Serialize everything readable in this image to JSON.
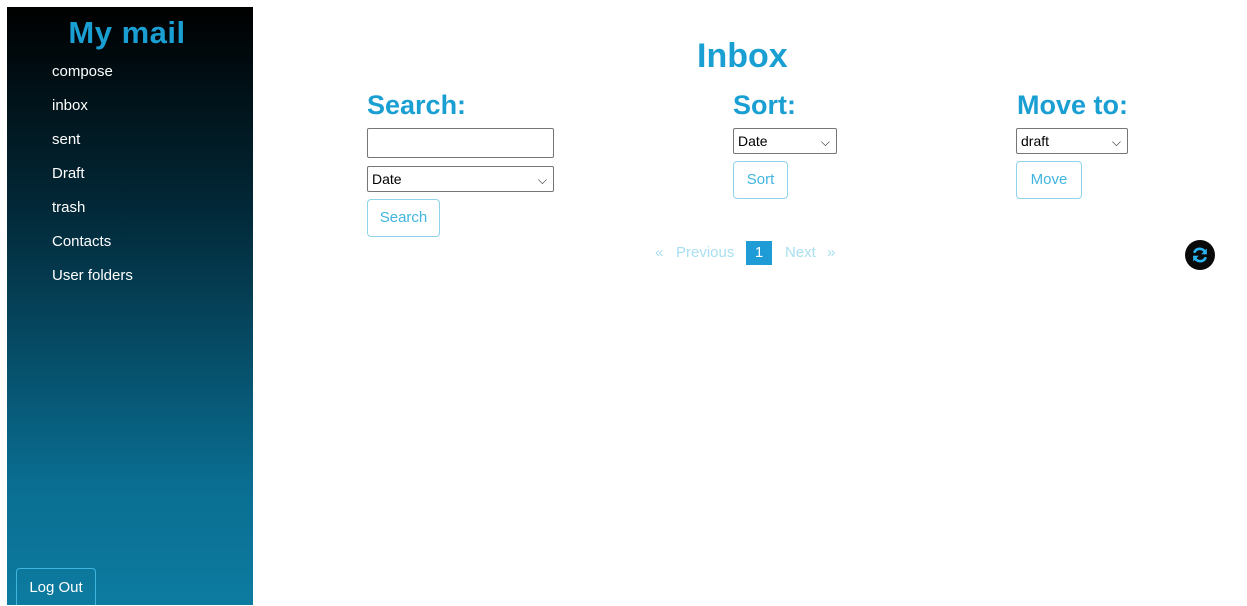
{
  "sidebar": {
    "brand": "My mail",
    "items": [
      {
        "label": "compose"
      },
      {
        "label": "inbox"
      },
      {
        "label": "sent"
      },
      {
        "label": "Draft"
      },
      {
        "label": "trash"
      },
      {
        "label": "Contacts"
      },
      {
        "label": "User folders"
      }
    ],
    "logout_label": "Log Out"
  },
  "main": {
    "title": "Inbox",
    "search": {
      "label": "Search:",
      "input_value": "",
      "select_value": "Date",
      "button_label": "Search"
    },
    "sort": {
      "label": "Sort:",
      "select_value": "Date",
      "button_label": "Sort"
    },
    "move": {
      "label": "Move to:",
      "select_value": "draft",
      "button_label": "Move"
    },
    "pagination": {
      "prev_arrow": "«",
      "prev_label": "Previous",
      "current_page": "1",
      "next_label": "Next",
      "next_arrow": "»"
    },
    "refresh_icon": "refresh-icon"
  },
  "colors": {
    "accent": "#1a9fd3",
    "active_page": "#1f9bd6",
    "button_text": "#3fb5e0"
  }
}
